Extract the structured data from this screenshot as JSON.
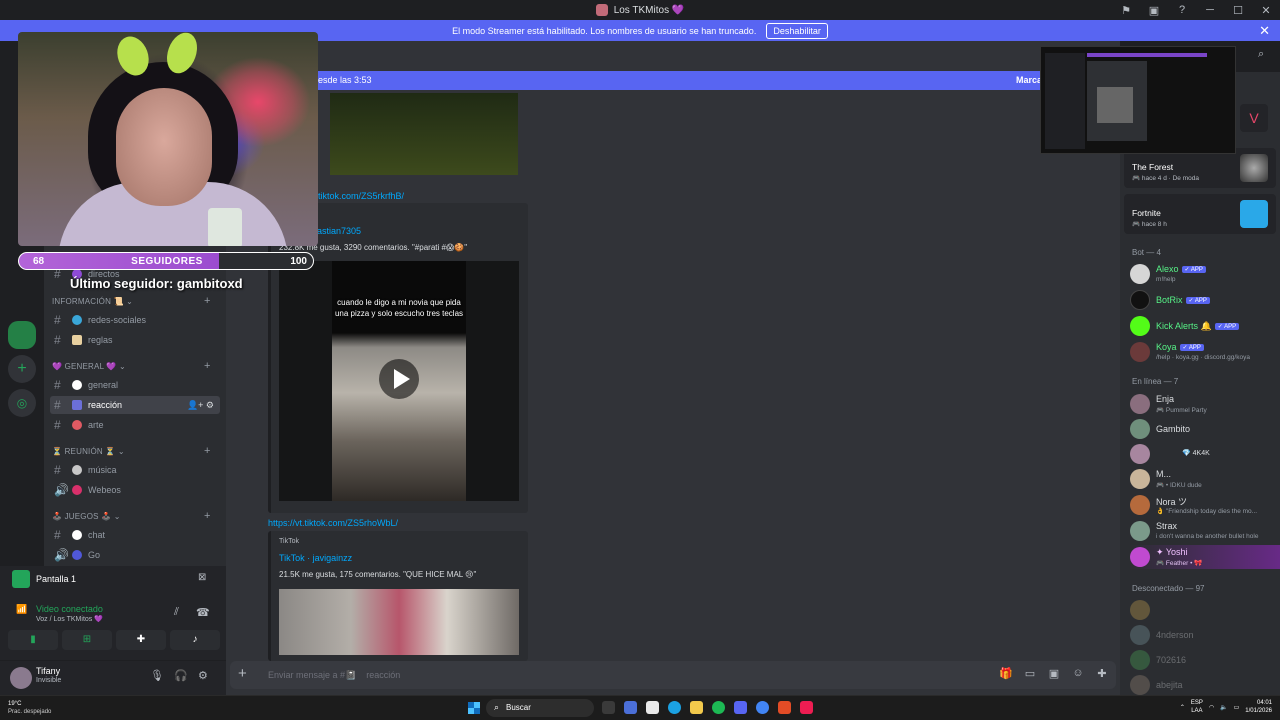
{
  "window": {
    "title": "Los TKMitos 💜"
  },
  "banner": {
    "text": "El modo Streamer está habilitado. Los nombres de usuario se han truncado.",
    "button": "Deshabilitar"
  },
  "new_messages": {
    "text": "esde las 3:53",
    "action": "Marca"
  },
  "overlay": {
    "followers_min": "68",
    "followers_label": "SEGUIDORES",
    "followers_max": "100",
    "last_follower": "Último seguidor: gambitoxd",
    "followers_progress": 0.68
  },
  "sidebar": {
    "partial_channel": "directos",
    "categories": {
      "info": "INFORMACIÓN 📜",
      "general": "💜 GENERAL 💜",
      "reunion": "⏳ REUNIÓN ⏳",
      "juegos": "🕹️ JUEGOS 🕹️"
    },
    "channels": {
      "redes": "redes-sociales",
      "reglas": "reglas",
      "general": "general",
      "reaccion": "reacción",
      "arte": "arte",
      "musica": "música",
      "webeos": "Webeos",
      "chat": "chat",
      "go": "Go"
    }
  },
  "voice": {
    "screen": "Pantalla 1",
    "status": "Video conectado",
    "location": "Voz / Los TKMitos 💜"
  },
  "user": {
    "name": "Tifany",
    "status": "Invisible"
  },
  "messages": {
    "link1": "tiktok.com/ZS5rkrfhB/",
    "embed1_author": "astian7305",
    "embed1_desc": "232.8K me gusta, 3290 comentarios. \"#parati #😱🍪\"",
    "video1_caption": "cuando le digo a mi novia que pida una pizza y solo escucho tres teclas",
    "link2": "https://vt.tiktok.com/ZS5rhoWbL/",
    "embed2_provider": "TikTok",
    "embed2_title": "TikTok · javigainzz",
    "embed2_desc": "21.5K me gusta, 175 comentarios. \"QUE HICE MAL 😢\""
  },
  "composer": {
    "placeholder": "Enviar mensaje a #📓",
    "channel": "reacción"
  },
  "members": {
    "activities": [
      {
        "name": "The Forest",
        "sub": "🎮 hace 4 d  ·  De moda"
      },
      {
        "name": "Fortnite",
        "sub": "🎮 hace 8 h"
      }
    ],
    "bot_header": "Bot — 4",
    "bots": [
      {
        "name": "Alexo",
        "tag": "✓ APP",
        "sub": "m!help",
        "color": "#57f287"
      },
      {
        "name": "BotRix",
        "tag": "✓ APP",
        "sub": "",
        "color": "#57f287"
      },
      {
        "name": "Kick Alerts 🔔",
        "tag": "✓ APP",
        "sub": "",
        "color": "#57f287"
      },
      {
        "name": "Koya",
        "tag": "✓ APP",
        "sub": "/help · koya.gg · discord.gg/koya",
        "color": "#57f287"
      }
    ],
    "online_header": "En línea — 7",
    "online": [
      {
        "name": "Enja",
        "sub": "🎮 Pummel Party"
      },
      {
        "name": "Gambito",
        "sub": ""
      },
      {
        "name": "💎 4K4K",
        "sub": ""
      },
      {
        "name": "M...",
        "sub": "🎮 • IDKU dude"
      },
      {
        "name": "Nora ツ",
        "sub": "👌 \"Friendship today dies the mo..."
      },
      {
        "name": "Strax",
        "sub": "i don't wanna be another bullet hole"
      },
      {
        "name": "✦ Yoshi",
        "sub": "🎮 Feather • 🎀"
      }
    ],
    "offline_header": "Desconectado — 97",
    "offline": [
      {
        "name": "",
        "sub": ""
      },
      {
        "name": "4nderson",
        "sub": ""
      },
      {
        "name": "702616",
        "sub": ""
      },
      {
        "name": "abejita",
        "sub": ""
      }
    ]
  },
  "taskbar": {
    "weather_temp": "19°C",
    "weather_desc": "Prac. despejado",
    "search": "Buscar",
    "lang": "ESP",
    "region": "LAA",
    "time": "04:01",
    "date": "1/01/2026"
  },
  "colors": {
    "accent": "#5865f2",
    "online": "#23a55a",
    "link": "#00a8fc"
  }
}
